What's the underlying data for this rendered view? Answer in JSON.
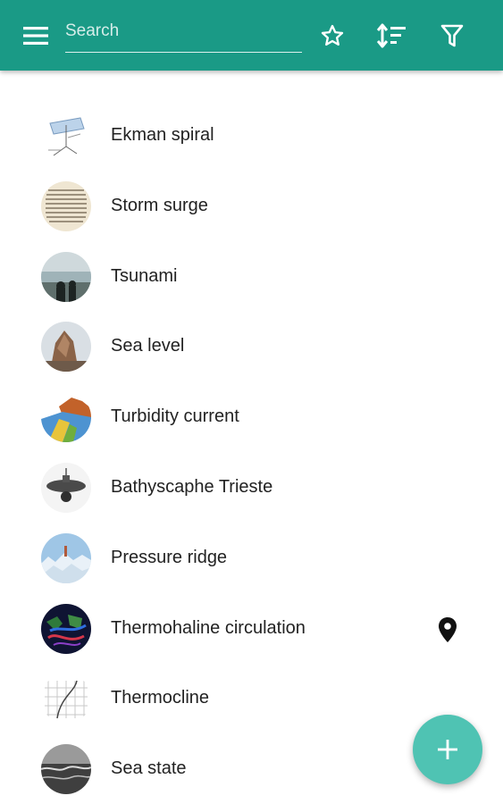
{
  "appbar": {
    "search_placeholder": "Search",
    "background_color": "#1a9a86",
    "icons": [
      "menu-icon",
      "star-outline-icon",
      "sort-icon",
      "filter-icon"
    ]
  },
  "items": [
    {
      "title": "Ekman spiral",
      "thumb": "ekman-spiral-thumbnail"
    },
    {
      "title": "Storm surge",
      "thumb": "storm-surge-thumbnail"
    },
    {
      "title": "Tsunami",
      "thumb": "tsunami-thumbnail"
    },
    {
      "title": "Sea level",
      "thumb": "sea-level-thumbnail"
    },
    {
      "title": "Turbidity current",
      "thumb": "turbidity-current-thumbnail"
    },
    {
      "title": "Bathyscaphe Trieste",
      "thumb": "bathyscaphe-trieste-thumbnail"
    },
    {
      "title": "Pressure ridge",
      "thumb": "pressure-ridge-thumbnail"
    },
    {
      "title": "Thermohaline circulation",
      "thumb": "thermohaline-circulation-thumbnail",
      "has_location": true,
      "location_icon": "location-pin-icon"
    },
    {
      "title": "Thermocline",
      "thumb": "thermocline-thumbnail"
    },
    {
      "title": "Sea state",
      "thumb": "sea-state-thumbnail"
    }
  ],
  "fab": {
    "icon": "plus-icon",
    "color": "#4fc3b3"
  }
}
